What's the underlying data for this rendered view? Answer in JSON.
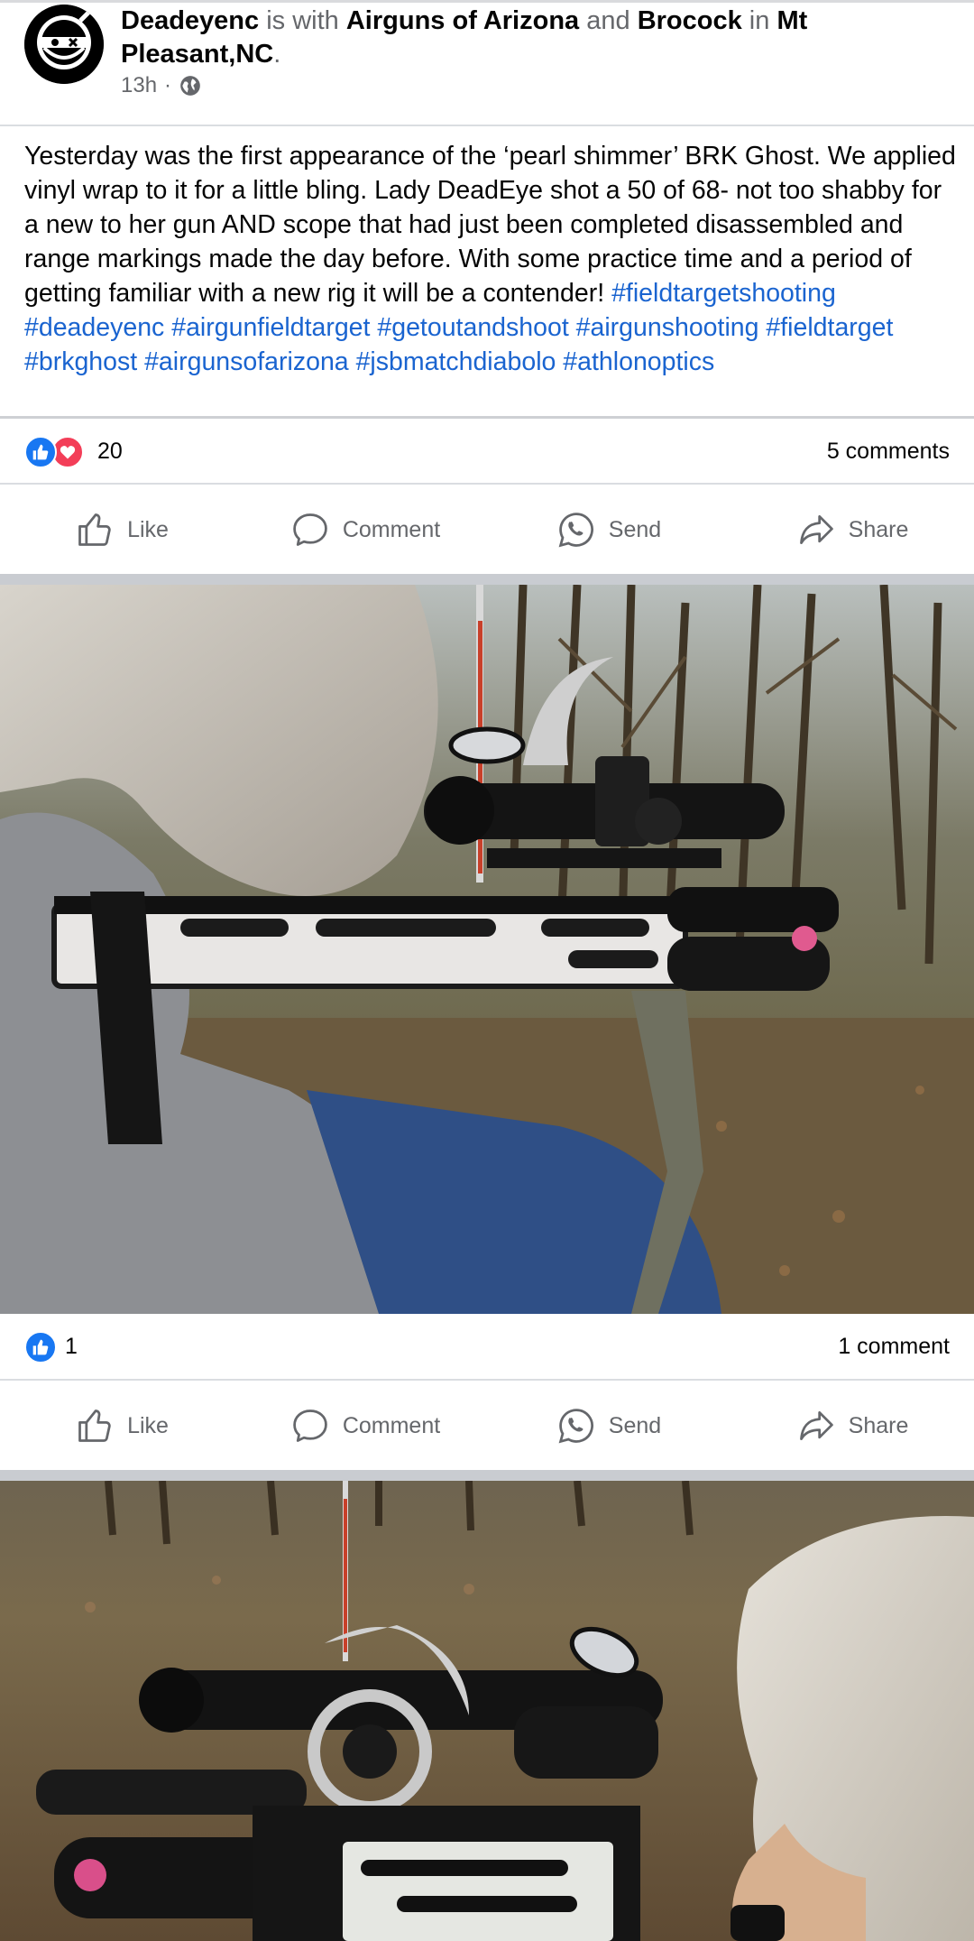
{
  "post": {
    "author": "Deadeyenc",
    "with_word": "is with",
    "tag1": "Airguns of Arizona",
    "and_word": "and",
    "tag2": "Brocock",
    "in_word": "in",
    "place": "Mt Pleasant,NC",
    "period": ".",
    "time": "13h",
    "dot": "·",
    "privacy_icon": "globe-icon",
    "caption": "Yesterday was the first appearance of the ‘pearl shimmer’ BRK Ghost. We applied vinyl wrap to it for a little bling. Lady DeadEye shot a 50 of 68- not too shabby for a new to her gun AND scope that had just been completed disassembled and range markings made the day before. With some practice time and a period of getting familiar with a new rig it will be a contender!",
    "hashtags": "#fieldtargetshooting #deadeyenc #airgunfieldtarget #getoutandshoot #airgunshooting #fieldtarget  #brkghost #airgunsofarizona #jsbmatchdiabolo #athlonoptics"
  },
  "post_stats": {
    "reaction_icons": [
      "like-reaction-icon",
      "love-reaction-icon"
    ],
    "reaction_count": "20",
    "comments": "5 comments"
  },
  "photo1_stats": {
    "reaction_icons": [
      "like-reaction-icon"
    ],
    "reaction_count": "1",
    "comments": "1 comment"
  },
  "actions": {
    "like": "Like",
    "comment": "Comment",
    "send": "Send",
    "share": "Share"
  },
  "colors": {
    "link": "#1a64d0",
    "secondary_text": "#65676b",
    "like_blue": "#1877f2",
    "love_red": "#f33e58"
  }
}
